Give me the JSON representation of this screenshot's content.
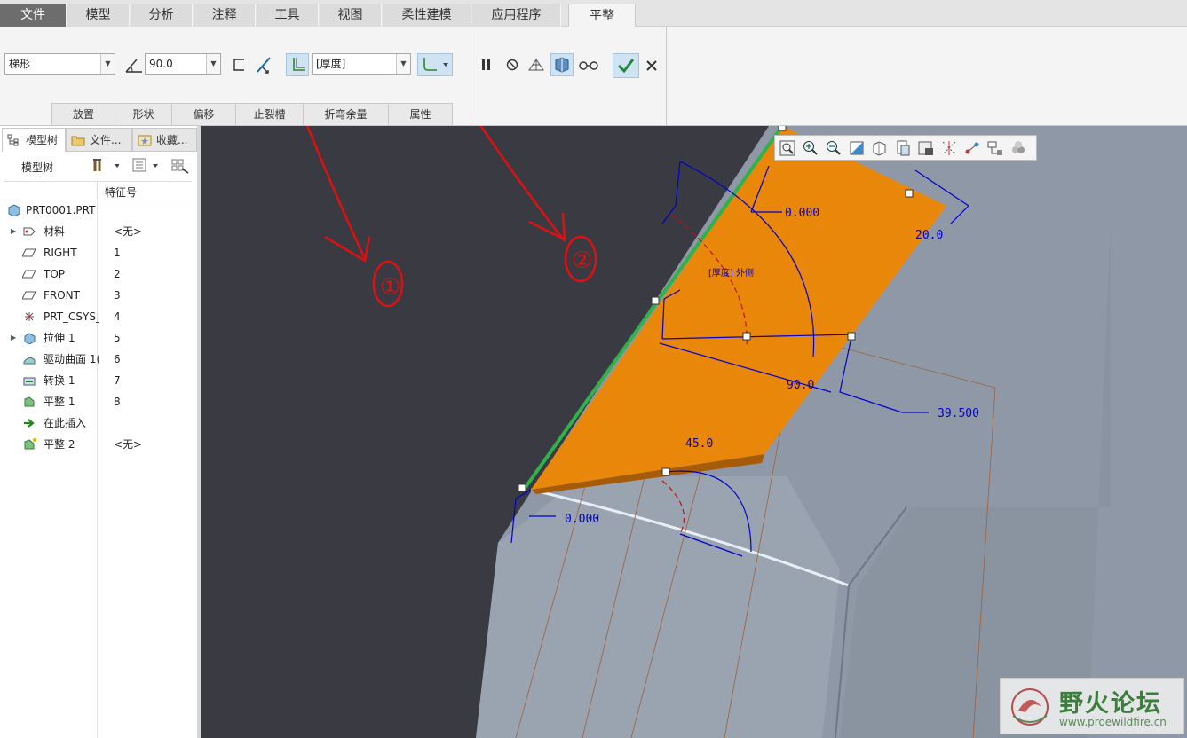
{
  "menu": {
    "tabs": [
      "文件",
      "模型",
      "分析",
      "注释",
      "工具",
      "视图",
      "柔性建模",
      "应用程序",
      "平整"
    ]
  },
  "ribbon": {
    "shape_value": "梯形",
    "angle_value": "90.0",
    "thickness_value": "[厚度]",
    "subtabs": [
      "放置",
      "形状",
      "偏移",
      "止裂槽",
      "折弯余量",
      "属性"
    ]
  },
  "left_panel": {
    "tabs": [
      "模型树",
      "文件...",
      "收藏..."
    ],
    "tree_header": "模型树",
    "column_header": "特征号",
    "root": "PRT0001.PRT",
    "items": [
      {
        "name": "材料",
        "num": "<无>",
        "expandable": true,
        "icon": "material-icon"
      },
      {
        "name": "RIGHT",
        "num": "1",
        "expandable": false,
        "icon": "datum-plane-icon"
      },
      {
        "name": "TOP",
        "num": "2",
        "expandable": false,
        "icon": "datum-plane-icon"
      },
      {
        "name": "FRONT",
        "num": "3",
        "expandable": false,
        "icon": "datum-plane-icon"
      },
      {
        "name": "PRT_CSYS_",
        "num": "4",
        "expandable": false,
        "icon": "csys-icon"
      },
      {
        "name": "拉伸 1",
        "num": "5",
        "expandable": true,
        "icon": "extrude-icon"
      },
      {
        "name": "驱动曲面 1(",
        "num": "6",
        "expandable": false,
        "icon": "driving-surface-icon"
      },
      {
        "name": "转换 1",
        "num": "7",
        "expandable": false,
        "icon": "convert-icon"
      },
      {
        "name": "平整 1",
        "num": "8",
        "expandable": false,
        "icon": "flat-wall-icon"
      },
      {
        "name": "在此插入",
        "num": "",
        "expandable": false,
        "icon": "insert-here-icon"
      },
      {
        "name": "平整 2",
        "num": "<无>",
        "expandable": false,
        "icon": "flat-wall-new-icon"
      }
    ]
  },
  "viewport": {
    "dimensions": {
      "d1": "0.000",
      "d2": "20.0",
      "d3": "90.0",
      "d4": "39.500",
      "d5": "45.0",
      "d6": "0.000",
      "thickness_label": "[厚度] 外侧"
    },
    "annotations": [
      "①",
      "②"
    ],
    "watermark": {
      "title": "野火论坛",
      "url": "www.proewildfire.cn"
    }
  },
  "colors": {
    "viewport_bg": "#3a3a42",
    "wall_orange": "#e8870a",
    "edge_green": "#2fb24a",
    "dim_blue": "#0000cc",
    "annotation_red": "#e01010",
    "body_gray": "#8f98a6"
  }
}
